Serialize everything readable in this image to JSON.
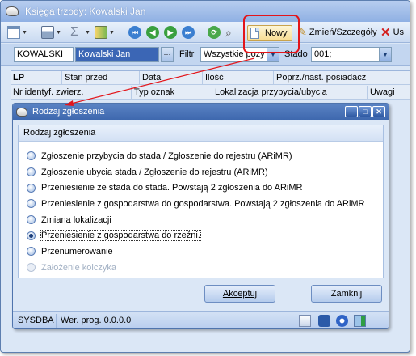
{
  "main_window": {
    "title": "Księga trzody: Kowalski Jan"
  },
  "toolbar": {
    "nowy_label": "Nowy",
    "zmien_label": "Zmień/Szczegóły",
    "usun_label": "Us"
  },
  "filterbar": {
    "owner_code": "KOWALSKI",
    "owner_name": "Kowalski Jan",
    "filter_label": "Filtr",
    "filter_value": "Wszystkie pozy",
    "stado_label": "Stado",
    "stado_value": "001;"
  },
  "grid": {
    "row1": [
      "LP",
      "Stan przed",
      "Data",
      "Ilość",
      "Poprz./nast. posiadacz"
    ],
    "row2": [
      "Nr identyf. zwierz.",
      "Typ oznak",
      "Lokalizacja przybycia/ubycia",
      "Uwagi"
    ]
  },
  "dialog": {
    "title": "Rodzaj zgłoszenia",
    "group_header": "Rodzaj zgłoszenia",
    "options": [
      "Zgłoszenie przybycia do stada / Zgłoszenie do rejestru (ARiMR)",
      "Zgłoszenie ubycia stada / Zgłoszenie do rejestru (ARiMR)",
      "Przeniesienie ze stada do stada. Powstają 2 zgłoszenia do ARiMR",
      "Przeniesienie z gospodarstwa do gospodarstwa. Powstają 2 zgłoszenia do ARiMR",
      "Zmiana lokalizacji",
      "Przeniesienie z gospodarstwa do rzeźni.",
      "Przenumerowanie",
      "Założenie kolczyka"
    ],
    "selected_index": 5,
    "disabled_index": 7,
    "accept_label": "Akceptuj",
    "close_label": "Zamknij"
  },
  "statusbar": {
    "user": "SYSDBA",
    "version": "Wer. prog. 0.0.0.0"
  },
  "colors": {
    "highlight": "#e3151a",
    "dialog_title": "#3e68ae",
    "window_bg": "#dbe7f6"
  }
}
